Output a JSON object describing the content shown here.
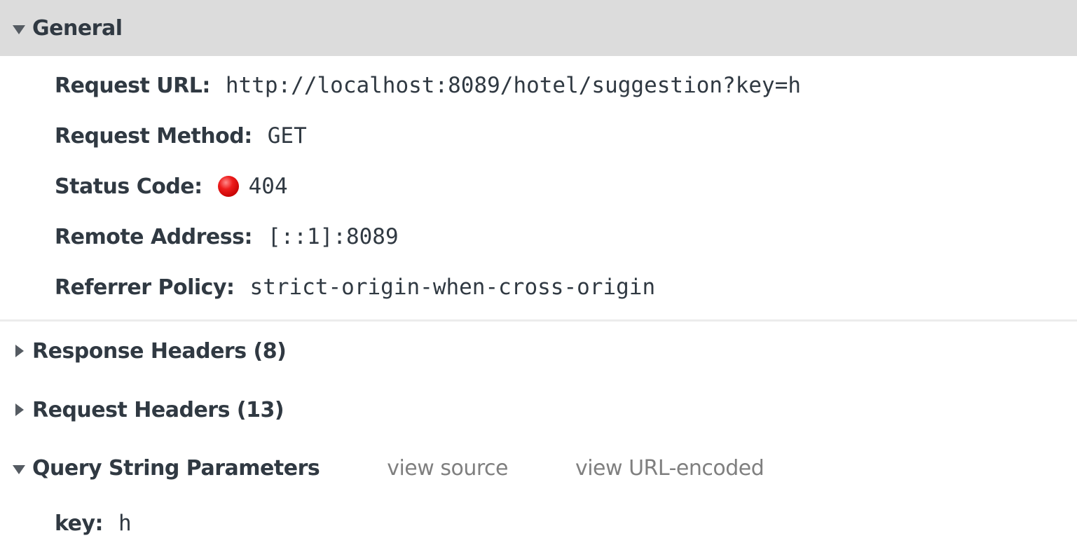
{
  "general": {
    "title": "General",
    "rows": [
      {
        "key": "Request URL:",
        "value": "http://localhost:8089/hotel/suggestion?key=h"
      },
      {
        "key": "Request Method:",
        "value": "GET"
      },
      {
        "key": "Status Code:",
        "value": "404"
      },
      {
        "key": "Remote Address:",
        "value": "[::1]:8089"
      },
      {
        "key": "Referrer Policy:",
        "value": "strict-origin-when-cross-origin"
      }
    ]
  },
  "response_headers": {
    "title": "Response Headers (8)"
  },
  "request_headers": {
    "title": "Request Headers (13)"
  },
  "query_string": {
    "title": "Query String Parameters",
    "view_source": "view source",
    "view_url_encoded": "view URL-encoded",
    "params": [
      {
        "key": "key:",
        "value": "h"
      }
    ]
  },
  "icons": {
    "expanded": "triangle-down-icon",
    "collapsed": "triangle-right-icon",
    "status": "status-error-dot-icon"
  },
  "colors": {
    "header_bg": "#dcdcdc",
    "text": "#303942",
    "link": "#7f7f7f",
    "status_error": "#ee1c1c"
  }
}
